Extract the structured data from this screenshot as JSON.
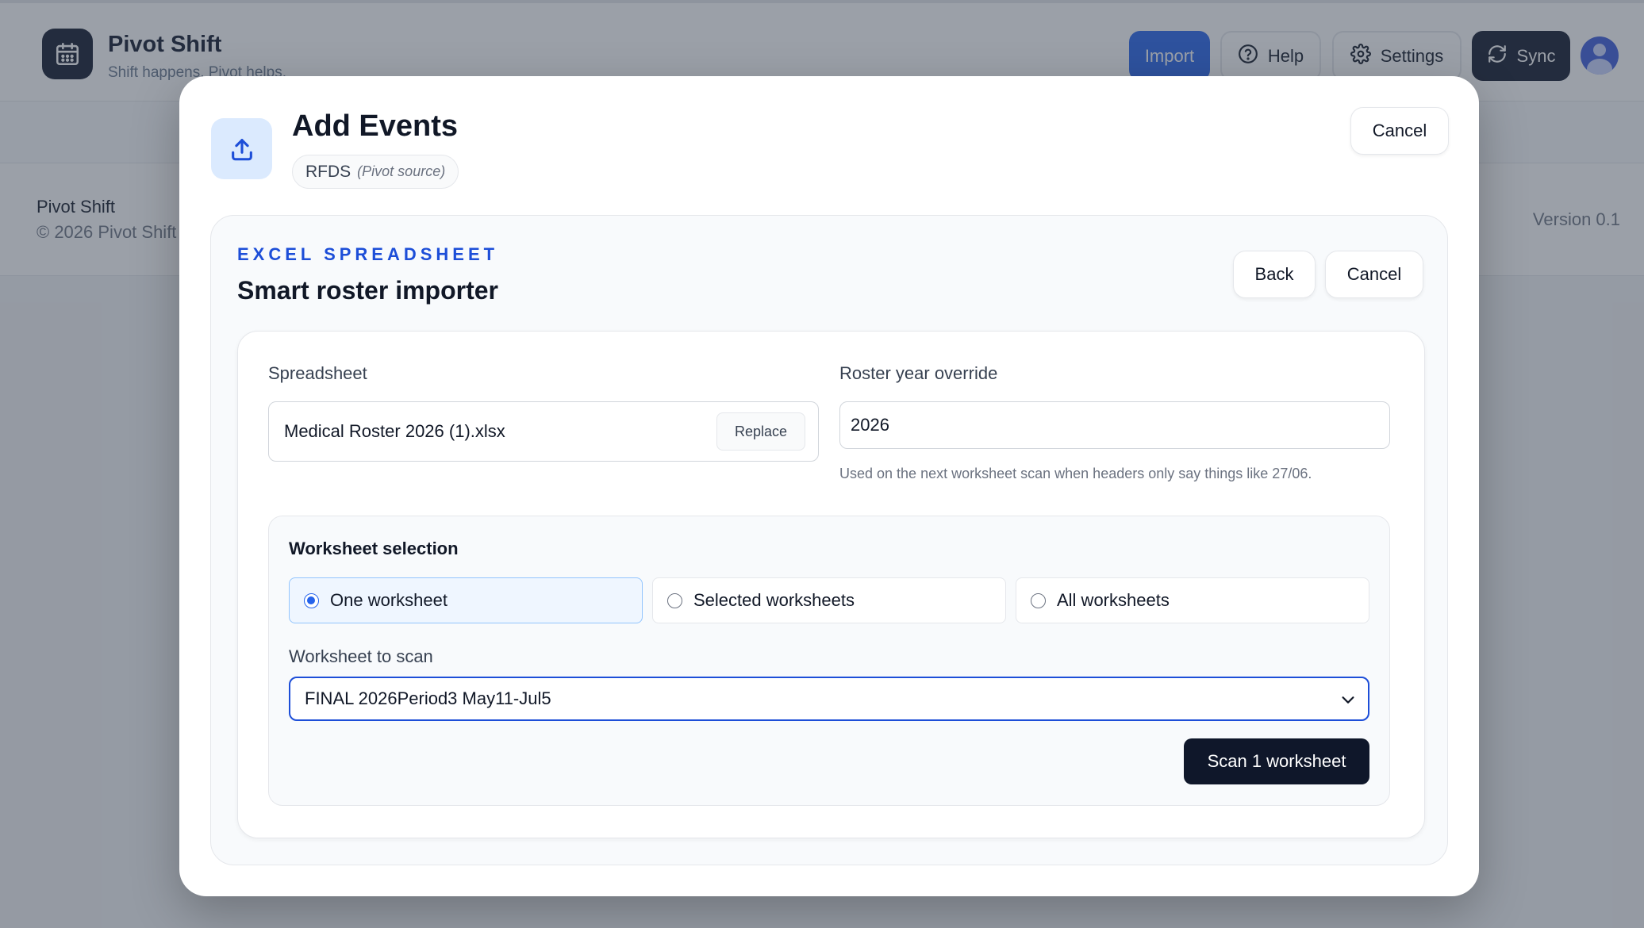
{
  "app": {
    "title": "Pivot Shift",
    "tagline": "Shift happens. Pivot helps.",
    "brand_icon": "calendar-icon"
  },
  "header": {
    "import_label": "Import",
    "help_label": "Help",
    "settings_label": "Settings",
    "sync_label": "Sync",
    "accent_color": "#2563eb"
  },
  "footer": {
    "name": "Pivot Shift",
    "copyright": "© 2026 Pivot Shift",
    "version": "Version 0.1"
  },
  "modal": {
    "title": "Add Events",
    "icon": "upload-icon",
    "source_name": "RFDS",
    "source_note": "(Pivot source)",
    "cancel_label": "Cancel"
  },
  "importer": {
    "eyebrow": "EXCEL SPREADSHEET",
    "title": "Smart roster importer",
    "back_label": "Back",
    "cancel_label": "Cancel",
    "spreadsheet_label": "Spreadsheet",
    "file_name": "Medical Roster 2026 (1).xlsx",
    "replace_label": "Replace",
    "year_label": "Roster year override",
    "year_value": "2026",
    "year_helper": "Used on the next worksheet scan when headers only say things like 27/06.",
    "worksheet_selection": {
      "title": "Worksheet selection",
      "options": [
        {
          "label": "One worksheet",
          "selected": true
        },
        {
          "label": "Selected worksheets",
          "selected": false
        },
        {
          "label": "All worksheets",
          "selected": false
        }
      ],
      "scan_label": "Worksheet to scan",
      "selected_sheet": "FINAL 2026Period3 May11-Jul5",
      "scan_button": "Scan 1 worksheet"
    }
  }
}
